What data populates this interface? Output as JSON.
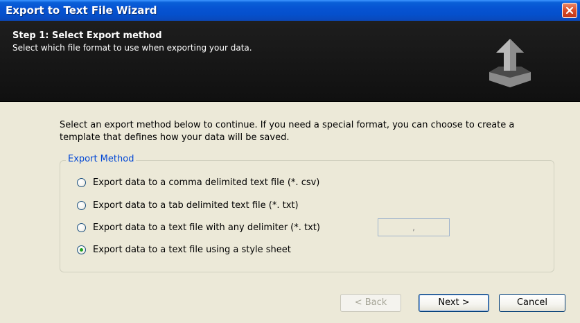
{
  "window": {
    "title": "Export to Text File Wizard",
    "close_label": "Close"
  },
  "header": {
    "title": "Step 1: Select Export method",
    "subtitle": "Select which file format to use when exporting your data.",
    "icon": "export-arrow-icon"
  },
  "content": {
    "instructions": "Select an export method below to continue. If you need a special format, you can choose to create a template that defines how your data will be saved."
  },
  "export_method": {
    "legend": "Export Method",
    "options": [
      {
        "label": "Export data to a comma delimited text file (*. csv)",
        "selected": false
      },
      {
        "label": "Export data to a tab delimited text file (*. txt)",
        "selected": false
      },
      {
        "label": "Export data to a text file with any delimiter (*. txt)",
        "selected": false
      },
      {
        "label": "Export data to a text file using a style sheet",
        "selected": true
      }
    ],
    "delimiter_value": ","
  },
  "buttons": {
    "back": "< Back",
    "next": "Next >",
    "cancel": "Cancel"
  },
  "colors": {
    "titlebar": "#0653d2",
    "header_bg": "#141414",
    "legend": "#0046d5",
    "radio_selected": "#21a121",
    "dialog_bg": "#ece9d8"
  }
}
